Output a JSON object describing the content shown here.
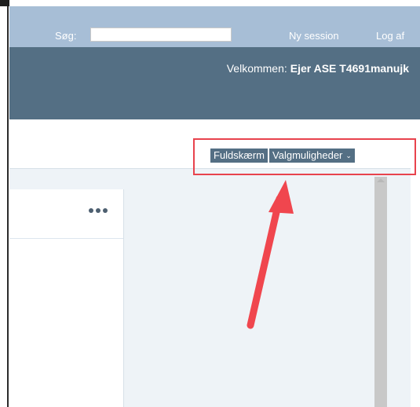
{
  "topbar": {
    "search_label": "Søg:",
    "search_value": "",
    "new_session": "Ny session",
    "logout": "Log af"
  },
  "header": {
    "welcome_label": "Velkommen:",
    "user_name": "Ejer ASE T4691manujk"
  },
  "toolbar": {
    "fullscreen": "Fuldskærm",
    "options": "Valgmuligheder",
    "options_chevron": "⌄"
  },
  "colors": {
    "topbar": "#a7bed6",
    "header": "#546f84",
    "button": "#546f84",
    "highlight": "#e8434d"
  }
}
